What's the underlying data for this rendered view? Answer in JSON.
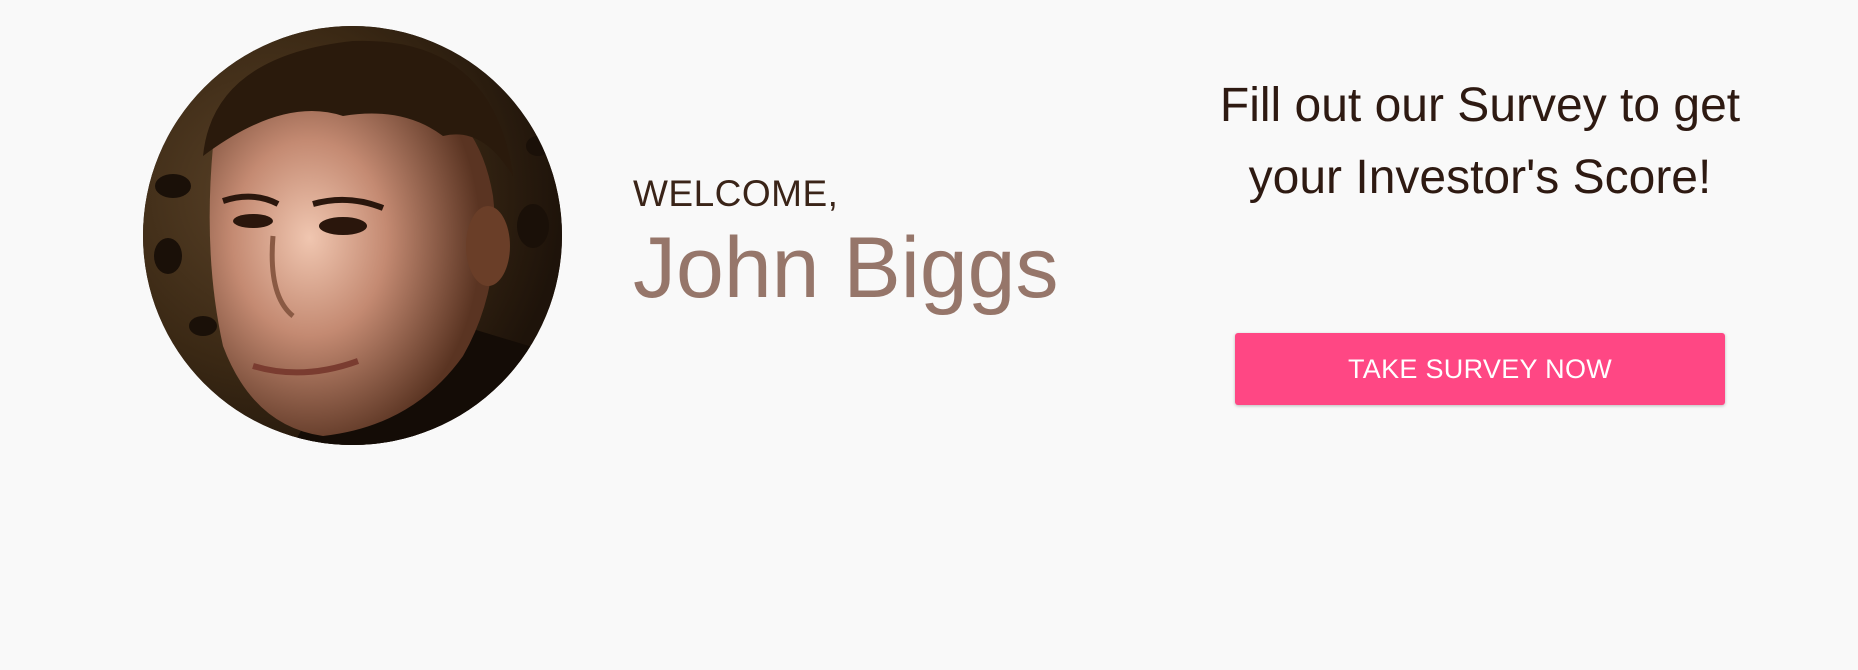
{
  "welcome": {
    "label": "WELCOME,",
    "name": "John Biggs"
  },
  "survey": {
    "prompt": "Fill out our Survey to get your Investor's Score!",
    "button_label": "TAKE SURVEY NOW"
  },
  "colors": {
    "background": "#f9f9f9",
    "accent": "#ff4784",
    "name_color": "#96766a",
    "text_color": "#2e1a12"
  },
  "icons": {
    "avatar": "user-profile-photo"
  }
}
